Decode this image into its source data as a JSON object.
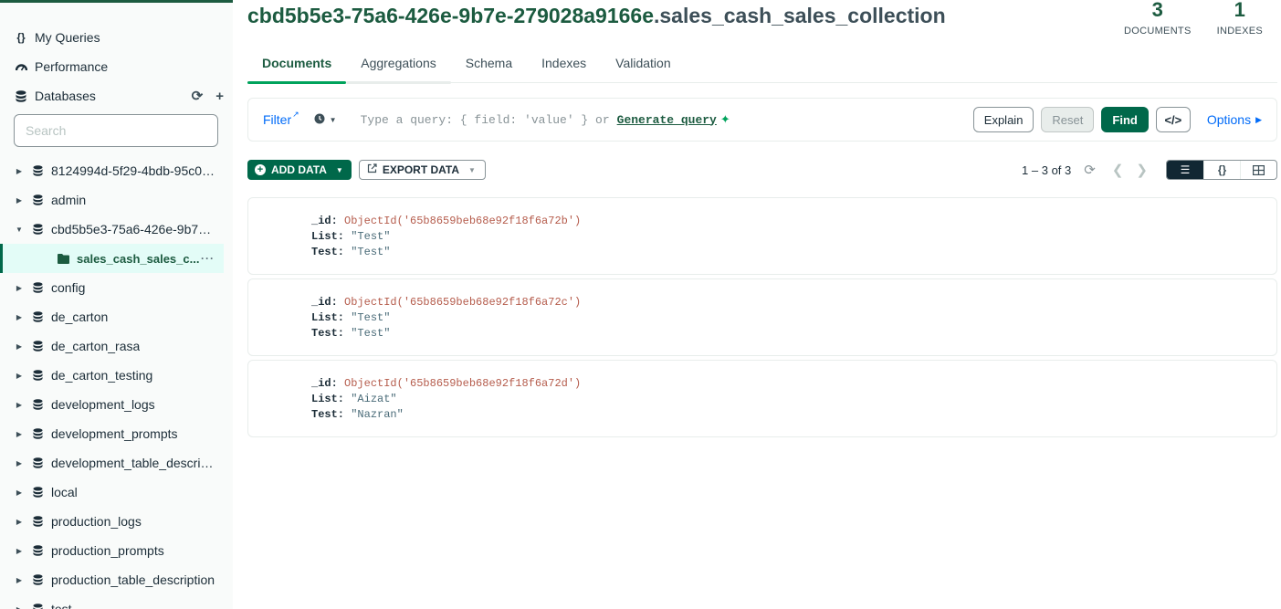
{
  "sidebar": {
    "nav": [
      {
        "label": "My Queries",
        "icon": "curly-braces-icon"
      },
      {
        "label": "Performance",
        "icon": "gauge-icon"
      },
      {
        "label": "Databases",
        "icon": "database-icon"
      }
    ],
    "search_placeholder": "Search",
    "databases": [
      {
        "label": "8124994d-5f29-4bdb-95c0-9...",
        "expanded": false
      },
      {
        "label": "admin",
        "expanded": false
      },
      {
        "label": "cbd5b5e3-75a6-426e-9b7e-...",
        "expanded": true
      },
      {
        "label": "config",
        "expanded": false
      },
      {
        "label": "de_carton",
        "expanded": false
      },
      {
        "label": "de_carton_rasa",
        "expanded": false
      },
      {
        "label": "de_carton_testing",
        "expanded": false
      },
      {
        "label": "development_logs",
        "expanded": false
      },
      {
        "label": "development_prompts",
        "expanded": false
      },
      {
        "label": "development_table_descrip...",
        "expanded": false
      },
      {
        "label": "local",
        "expanded": false
      },
      {
        "label": "production_logs",
        "expanded": false
      },
      {
        "label": "production_prompts",
        "expanded": false
      },
      {
        "label": "production_table_description",
        "expanded": false
      },
      {
        "label": "test",
        "expanded": false
      }
    ],
    "active_collection": "sales_cash_sales_c...",
    "more_label": "···"
  },
  "header": {
    "db_name": "cbd5b5e3-75a6-426e-9b7e-279028a9166e",
    "collection_name": ".sales_cash_sales_collection",
    "stats": [
      {
        "value": "3",
        "label": "DOCUMENTS"
      },
      {
        "value": "1",
        "label": "INDEXES"
      }
    ]
  },
  "tabs": [
    "Documents",
    "Aggregations",
    "Schema",
    "Indexes",
    "Validation"
  ],
  "query_bar": {
    "filter_label": "Filter",
    "placeholder": "Type a query: { field: 'value' } or",
    "generate_query": "Generate query",
    "explain": "Explain",
    "reset": "Reset",
    "find": "Find",
    "code": "</>",
    "options": "Options"
  },
  "toolbar": {
    "add_data": "ADD DATA",
    "export_data": "EXPORT DATA",
    "pagination": "1 – 3 of 3"
  },
  "documents": [
    {
      "id_key": "_id:",
      "id_value": "ObjectId('65b8659beb68e92f18f6a72b')",
      "list_key": "List:",
      "list_value": "\"Test\"",
      "test_key": "Test:",
      "test_value": "\"Test\""
    },
    {
      "id_key": "_id:",
      "id_value": "ObjectId('65b8659beb68e92f18f6a72c')",
      "list_key": "List:",
      "list_value": "\"Test\"",
      "test_key": "Test:",
      "test_value": "\"Test\""
    },
    {
      "id_key": "_id:",
      "id_value": "ObjectId('65b8659beb68e92f18f6a72d')",
      "list_key": "List:",
      "list_value": "\"Aizat\"",
      "test_key": "Test:",
      "test_value": "\"Nazran\""
    }
  ],
  "colors": {
    "brand_green": "#00684a",
    "dark_green": "#1c5b40",
    "link_blue": "#016bf8",
    "objectid": "#b55c4c"
  }
}
